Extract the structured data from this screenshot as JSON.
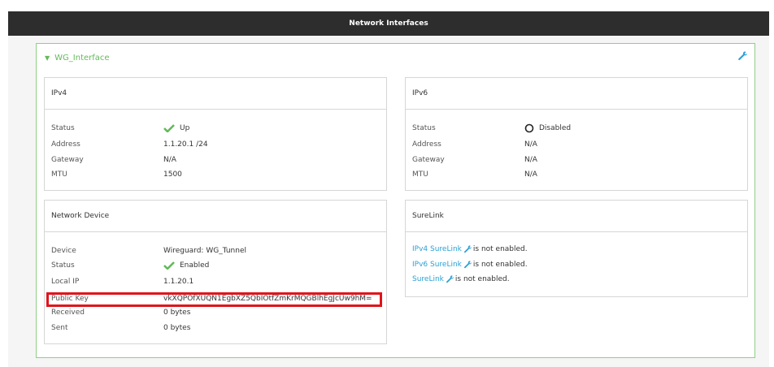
{
  "header": {
    "title": "Network Interfaces"
  },
  "interface": {
    "name": "WG_Interface"
  },
  "ipv4": {
    "title": "IPv4",
    "rows": [
      {
        "label": "Status",
        "value": "Up"
      },
      {
        "label": "Address",
        "value": "1.1.20.1 /24"
      },
      {
        "label": "Gateway",
        "value": "N/A"
      },
      {
        "label": "MTU",
        "value": "1500"
      }
    ]
  },
  "ipv6": {
    "title": "IPv6",
    "rows": [
      {
        "label": "Status",
        "value": "Disabled"
      },
      {
        "label": "Address",
        "value": "N/A"
      },
      {
        "label": "Gateway",
        "value": "N/A"
      },
      {
        "label": "MTU",
        "value": "N/A"
      }
    ]
  },
  "network_device": {
    "title": "Network Device",
    "rows": [
      {
        "label": "Device",
        "value": "Wireguard: WG_Tunnel"
      },
      {
        "label": "Status",
        "value": "Enabled"
      },
      {
        "label": "Local IP",
        "value": "1.1.20.1"
      },
      {
        "label": "Public Key",
        "value": "vkXQPOfXUQN1EgbXZ5QbIOtfZmKrMQGBlhEgJcUw9hM="
      },
      {
        "label": "Received",
        "value": "0 bytes"
      },
      {
        "label": "Sent",
        "value": "0 bytes"
      }
    ]
  },
  "surelink": {
    "title": "SureLink",
    "rows": [
      {
        "link": "IPv4 SureLink",
        "text": " is not enabled."
      },
      {
        "link": "IPv6 SureLink",
        "text": " is not enabled."
      },
      {
        "link": "SureLink",
        "text": " is not enabled."
      }
    ]
  },
  "colors": {
    "accent": "#64b95b",
    "link": "#2aa1d6",
    "highlight": "#e0141c",
    "header_bg": "#2d2d2d"
  },
  "icons": {
    "collapse": "caret-down-icon",
    "configure": "wrench-icon",
    "status_up": "check-icon",
    "status_disabled": "circle-icon"
  }
}
